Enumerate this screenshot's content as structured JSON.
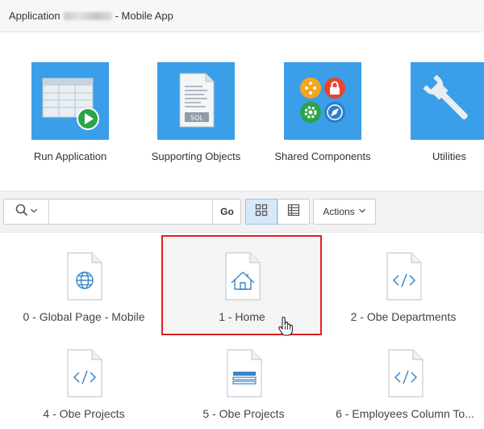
{
  "titlebar": {
    "prefix": "Application",
    "suffix": "- Mobile App"
  },
  "tiles": [
    {
      "label": "Run Application",
      "icon": "run-application-icon"
    },
    {
      "label": "Supporting Objects",
      "icon": "supporting-objects-icon"
    },
    {
      "label": "Shared Components",
      "icon": "shared-components-icon"
    },
    {
      "label": "Utilities",
      "icon": "utilities-icon"
    }
  ],
  "toolbar": {
    "search_value": "",
    "go_label": "Go",
    "actions_label": "Actions",
    "active_view": "icons"
  },
  "pages": [
    {
      "label": "0 - Global Page - Mobile",
      "icon": "globe-icon"
    },
    {
      "label": "1 - Home",
      "icon": "home-icon",
      "selected": true
    },
    {
      "label": "2 - Obe Departments",
      "icon": "code-icon"
    },
    {
      "label": "4 - Obe Projects",
      "icon": "code-icon"
    },
    {
      "label": "5 - Obe Projects",
      "icon": "form-icon"
    },
    {
      "label": "6 - Employees Column To..."
    }
  ],
  "colors": {
    "tile_blue": "#3a9ee8",
    "icon_blue": "#3a86c8",
    "selection_red": "#e02020",
    "active_view_bg": "#d7e8f8"
  }
}
